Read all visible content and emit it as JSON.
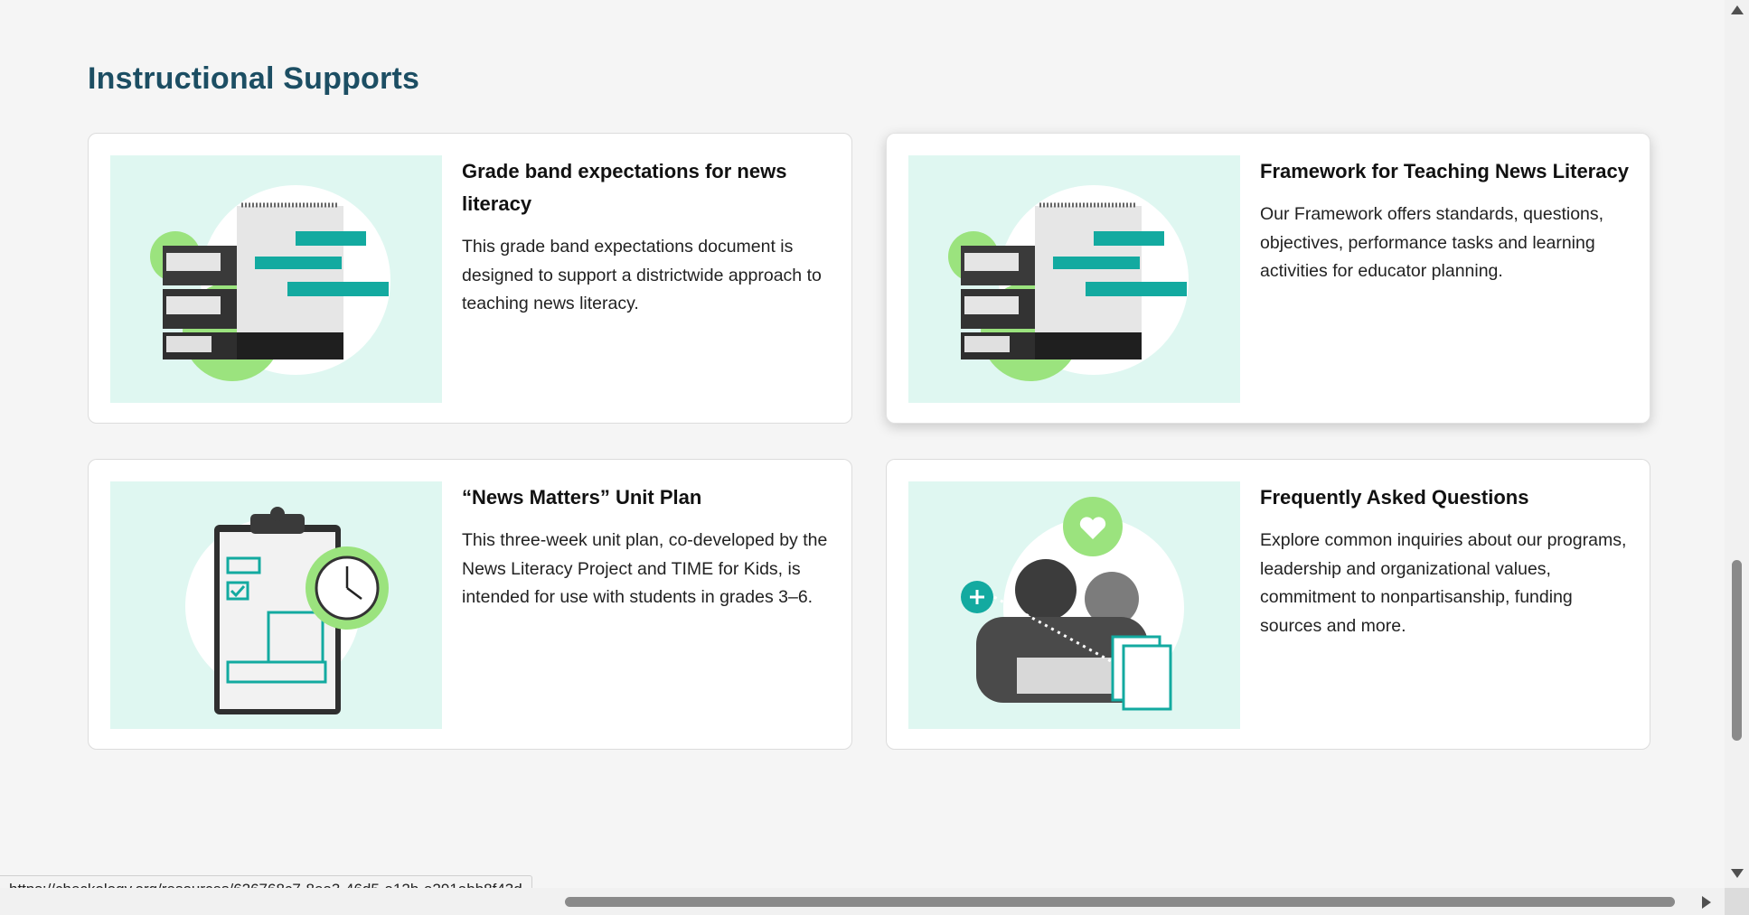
{
  "section": {
    "title": "Instructional Supports"
  },
  "cards": [
    {
      "title": "Grade band expectations for news literacy",
      "description": "This grade band expectations document is designed to support a districtwide approach to teaching news literacy.",
      "image_icon": "calendar-binders-illustration"
    },
    {
      "title": "Framework for Teaching News Literacy",
      "description": "Our Framework offers standards, questions, objectives, performance tasks and learning activities for educator planning.",
      "image_icon": "calendar-binders-illustration"
    },
    {
      "title": "“News Matters” Unit Plan",
      "description": "This three-week unit plan, co-developed by the News Literacy Project and TIME for Kids, is intended for use with students in grades 3–6.",
      "image_icon": "clipboard-clock-illustration"
    },
    {
      "title": "Frequently Asked Questions",
      "description": "Explore common inquiries about our programs, leadership and organizational values, commitment to nonpartisanship, funding sources and more.",
      "image_icon": "reading-family-illustration"
    }
  ],
  "statusbar": {
    "url": "https://checkology.org/resources/626768c7-8ea3-46d5-a12b-a291abb8f43d"
  },
  "colors": {
    "heading": "#1c4e63",
    "image_bg": "#dff7f1",
    "teal": "#13aaa0",
    "green": "#9be37e"
  }
}
